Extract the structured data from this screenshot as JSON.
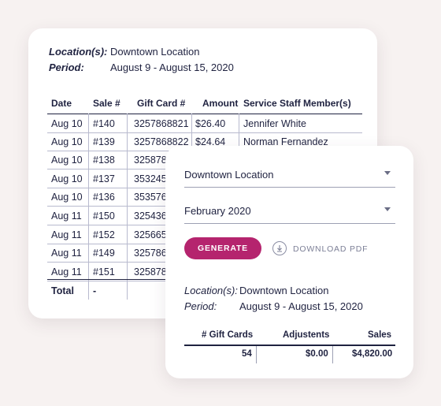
{
  "report": {
    "location_label": "Location(s):",
    "location_value": "Downtown Location",
    "period_label": "Period:",
    "period_value": "August 9 - August 15, 2020",
    "columns": [
      "Date",
      "Sale #",
      "Gift Card #",
      "Amount",
      "Service Staff Member(s)"
    ],
    "rows": [
      {
        "date": "Aug 10",
        "sale": "#140",
        "card": "3257868821",
        "amount": "$26.40",
        "staff": "Jennifer White"
      },
      {
        "date": "Aug 10",
        "sale": "#139",
        "card": "3257868822",
        "amount": "$24.64",
        "staff": "Norman Fernandez"
      },
      {
        "date": "Aug 10",
        "sale": "#138",
        "card": "325878",
        "amount": "",
        "staff": ""
      },
      {
        "date": "Aug 10",
        "sale": "#137",
        "card": "353245",
        "amount": "",
        "staff": ""
      },
      {
        "date": "Aug 10",
        "sale": "#136",
        "card": "353576",
        "amount": "",
        "staff": ""
      },
      {
        "date": "Aug 11",
        "sale": "#150",
        "card": "325436",
        "amount": "",
        "staff": ""
      },
      {
        "date": "Aug 11",
        "sale": "#152",
        "card": "325665",
        "amount": "",
        "staff": ""
      },
      {
        "date": "Aug 11",
        "sale": "#149",
        "card": "325786",
        "amount": "",
        "staff": ""
      },
      {
        "date": "Aug 11",
        "sale": "#151",
        "card": "325878",
        "amount": "",
        "staff": ""
      }
    ],
    "total_label": "Total",
    "total_sale": "-"
  },
  "form": {
    "location_select": "Downtown Location",
    "month_select": "February 2020",
    "generate_label": "GENERATE",
    "download_label": "DOWNLOAD PDF",
    "location_label": "Location(s):",
    "location_value": "Downtown Location",
    "period_label": "Period:",
    "period_value": "August 9 - August 15, 2020",
    "summary_headers": [
      "# Gift Cards",
      "Adjustents",
      "Sales"
    ],
    "summary_values": [
      "54",
      "$0.00",
      "$4,820.00"
    ]
  },
  "colors": {
    "accent": "#b5246e",
    "text": "#1f2240",
    "background": "#f7f2f1"
  },
  "icons": [
    "chevron-down-icon",
    "download-icon"
  ]
}
